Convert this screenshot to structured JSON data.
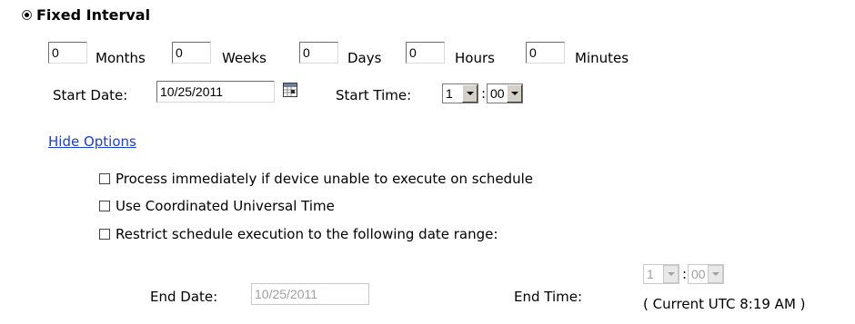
{
  "schedule": {
    "mode_label": "Fixed Interval",
    "interval": {
      "months_value": "0",
      "months_label": "Months",
      "weeks_value": "0",
      "weeks_label": "Weeks",
      "days_value": "0",
      "days_label": "Days",
      "hours_value": "0",
      "hours_label": "Hours",
      "minutes_value": "0",
      "minutes_label": "Minutes"
    },
    "start_date_label": "Start Date:",
    "start_date_value": "10/25/2011",
    "start_time_label": "Start Time:",
    "start_hour": "1",
    "time_sep": ":",
    "start_minute": "00",
    "hide_options_link": "Hide Options",
    "options": [
      {
        "label": "Process immediately if device unable to execute on schedule",
        "checked": false
      },
      {
        "label": "Use Coordinated Universal Time",
        "checked": false
      },
      {
        "label": "Restrict schedule execution to the following date range:",
        "checked": false
      }
    ],
    "end_date_label": "End Date:",
    "end_date_value": "10/25/2011",
    "end_time_label": "End Time:",
    "end_hour": "1",
    "end_minute": "00",
    "current_utc": "( Current UTC 8:19 AM )"
  },
  "icons": {
    "calendar": "calendar-icon",
    "dropdown": "chevron-down-icon"
  }
}
